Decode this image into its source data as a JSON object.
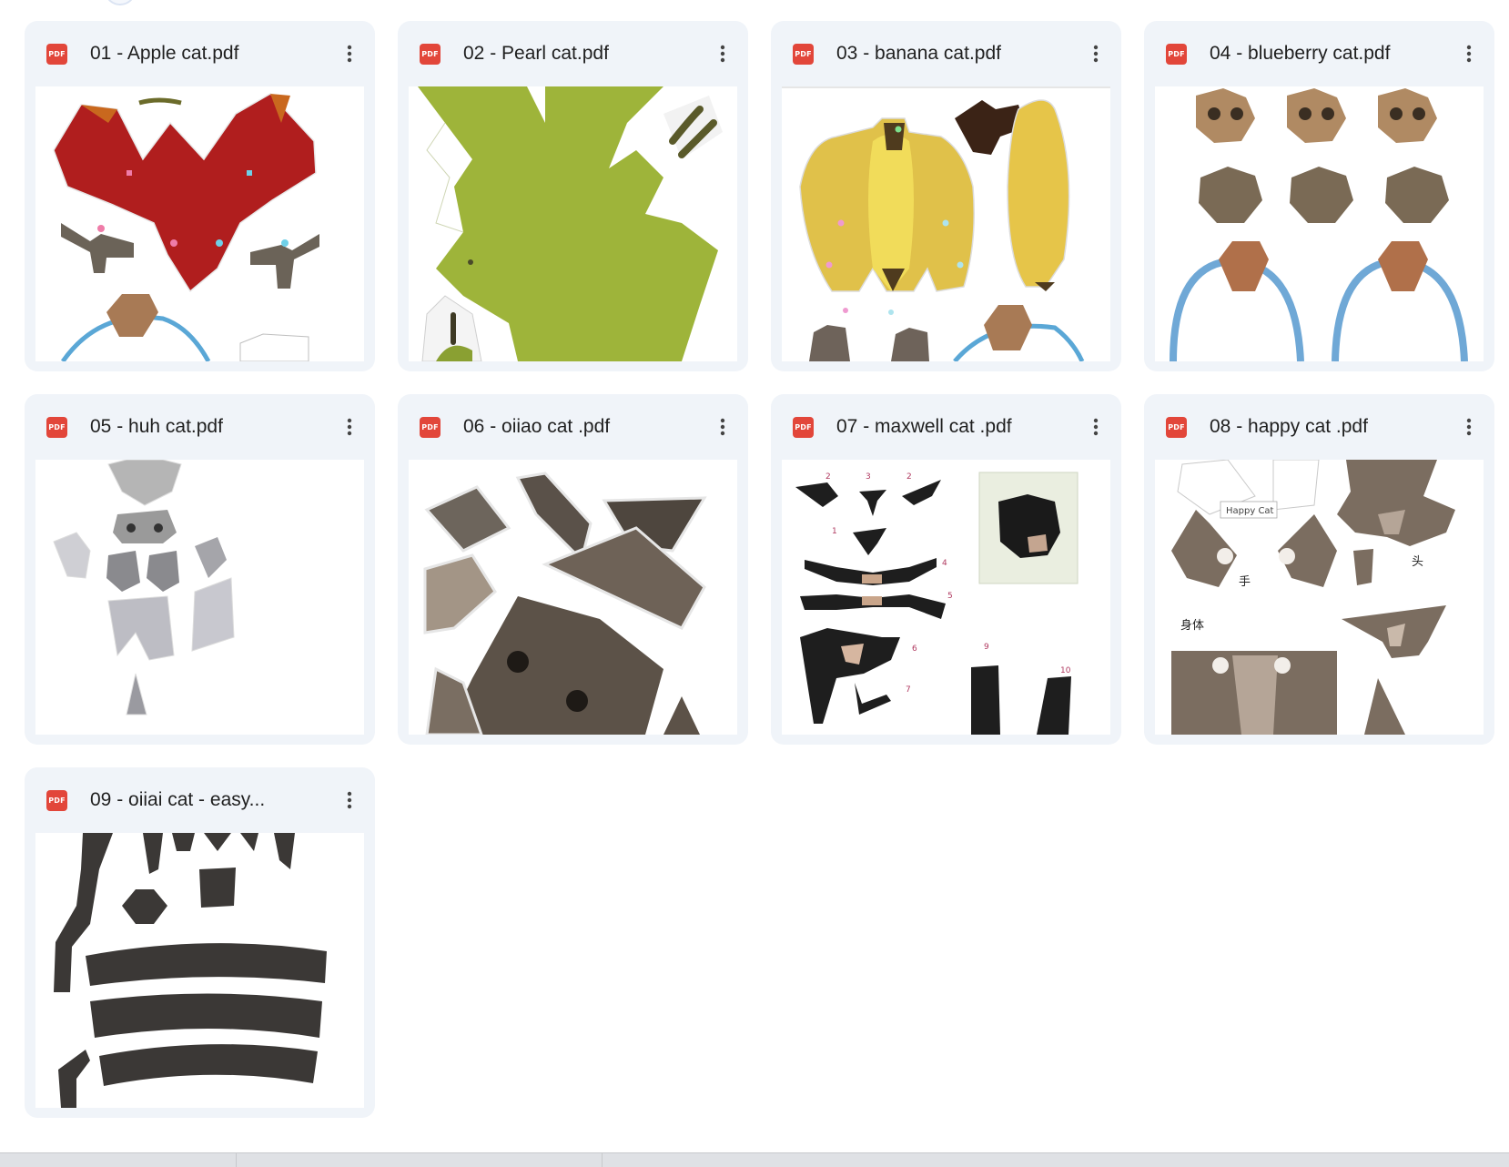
{
  "files": [
    {
      "name": "01 - Apple cat.pdf",
      "type_badge": "PDF",
      "thumbnail": "apple-cat-papercraft"
    },
    {
      "name": "02 - Pearl cat.pdf",
      "type_badge": "PDF",
      "thumbnail": "pearl-cat-papercraft"
    },
    {
      "name": "03 - banana cat.pdf",
      "type_badge": "PDF",
      "thumbnail": "banana-cat-papercraft"
    },
    {
      "name": "04 - blueberry cat.pdf",
      "type_badge": "PDF",
      "thumbnail": "blueberry-cat-papercraft"
    },
    {
      "name": "05 - huh cat.pdf",
      "type_badge": "PDF",
      "thumbnail": "huh-cat-papercraft"
    },
    {
      "name": "06 - oiiao cat .pdf",
      "type_badge": "PDF",
      "thumbnail": "oiiao-cat-papercraft"
    },
    {
      "name": "07 - maxwell cat .pdf",
      "type_badge": "PDF",
      "thumbnail": "maxwell-cat-papercraft"
    },
    {
      "name": "08 - happy cat .pdf",
      "type_badge": "PDF",
      "thumbnail": "happy-cat-papercraft"
    },
    {
      "name": "09 - oiiai cat - easy...",
      "type_badge": "PDF",
      "thumbnail": "oiiai-cat-easy-papercraft"
    }
  ],
  "thumb_labels": {
    "maxwell_numbers": [
      "2",
      "3",
      "2",
      "1",
      "4",
      "5",
      "6",
      "7",
      "9",
      "10"
    ],
    "happy_cat": {
      "label": "Happy Cat",
      "hand": "手",
      "head": "头",
      "body": "身体"
    }
  },
  "icons": {
    "file_type": "pdf-icon",
    "menu": "more-vertical-icon"
  },
  "colors": {
    "card_bg": "#f0f4f9",
    "pdf_red": "#e2463a",
    "text": "#1f1f1f"
  }
}
